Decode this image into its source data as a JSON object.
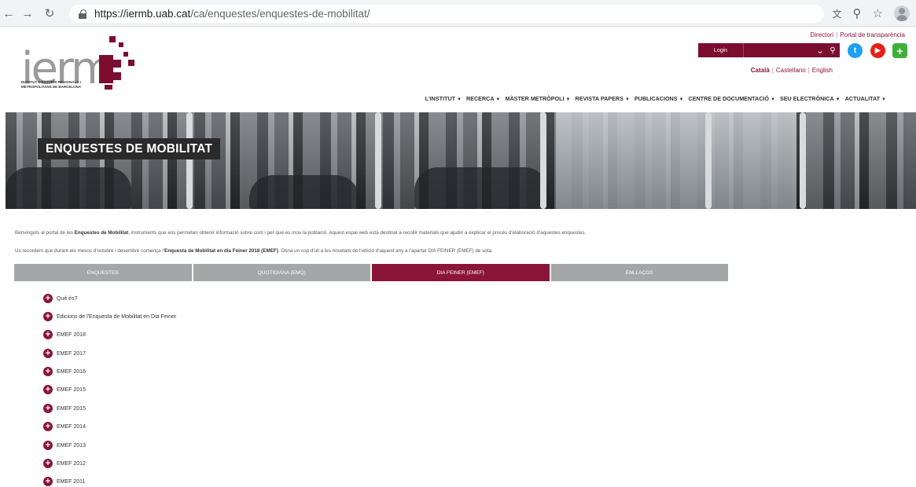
{
  "browser": {
    "url_host": "https://iermb.uab.cat",
    "url_path": "/ca/enquestes/enquestes-de-mobilitat/"
  },
  "header": {
    "logo_text": "ierm",
    "logo_subtitle": "INSTITUT D'ESTUDIS REGIONALS I METROPOLITANS DE BARCELONA",
    "top_links": [
      "Directori",
      "Portal de transparència"
    ],
    "login_label": "Login",
    "languages": [
      "Català",
      "Castellano",
      "English"
    ],
    "nav": [
      "L'INSTITUT",
      "RECERCA",
      "MÀSTER METRÒPOLI",
      "REVISTA PAPERS",
      "PUBLICACIONS",
      "CENTRE DE DOCUMENTACIÓ",
      "SEU ELECTRÒNICA",
      "ACTUALITAT"
    ]
  },
  "banner": {
    "title": "ENQUESTES DE MOBILITAT"
  },
  "intro": {
    "p1_a": "Benvinguts al portal de les ",
    "p1_b": "Enquestes de Mobilitat",
    "p1_c": ", instruments que ens permeten obtenir informació sobre com i per què es mou la població. Aquest espai web està destinat a recollir materials que ajudin a explicar el procés d'elaboració d'aquestes enquestes.",
    "p2_a": "Us recordem que durant els mesos d'octubre i desembre comença l'",
    "p2_b": "Enquesta de Mobilitat en dia Feiner 2018 (EMEF)",
    "p2_c": ". Dóna un cop d'ull a les novetats de l'edició d'aquest any a l'apartat DIA FEINER (EMEF) de sota."
  },
  "tabs": [
    "ENQUESTES",
    "QUOTIDIANA (EMQ)",
    "DIA FEINER (EMEF)",
    "ENLLAÇOS"
  ],
  "active_tab": "DIA FEINER (EMEF)",
  "accordion": [
    "Què és?",
    "Edicions de l'Enquesta de Mobilitat en Dia Feiner",
    "EMEF 2018",
    "EMEF 2017",
    "EMEF 2016",
    "EMEF 2015",
    "EMEF 2015",
    "EMEF 2014",
    "EMEF 2013",
    "EMEF 2012",
    "EMEF 2011"
  ],
  "colors": {
    "brand": "#8a1538",
    "tab_inactive": "#a5a6a8",
    "banner_label_bg": "#2a2a2a"
  }
}
